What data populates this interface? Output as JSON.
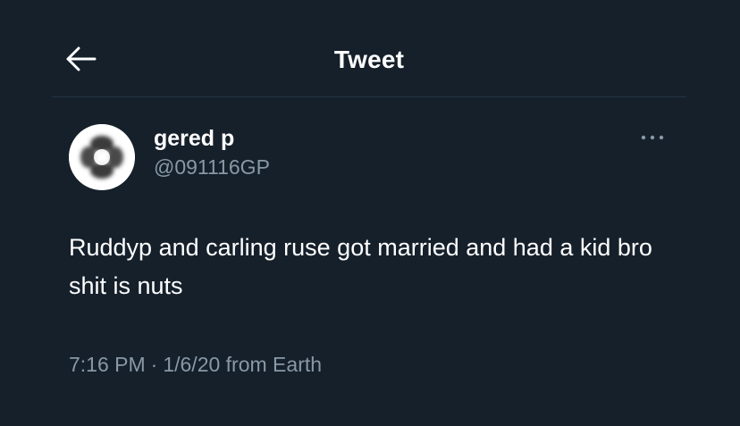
{
  "header": {
    "title": "Tweet",
    "back_icon": "arrow-left-icon"
  },
  "tweet": {
    "author": {
      "display_name": "gered p",
      "handle": "@091116GP",
      "avatar_icon": "avatar-image"
    },
    "more_icon": "more-dots-icon",
    "text": "Ruddyp and carling ruse got married and had a kid bro shit is nuts",
    "time": "7:16 PM",
    "separator": "·",
    "date": "1/6/20",
    "source": "from Earth"
  },
  "colors": {
    "background": "#15202b",
    "primary_text": "#ffffff",
    "secondary_text": "#8899a6",
    "divider": "#253341"
  }
}
